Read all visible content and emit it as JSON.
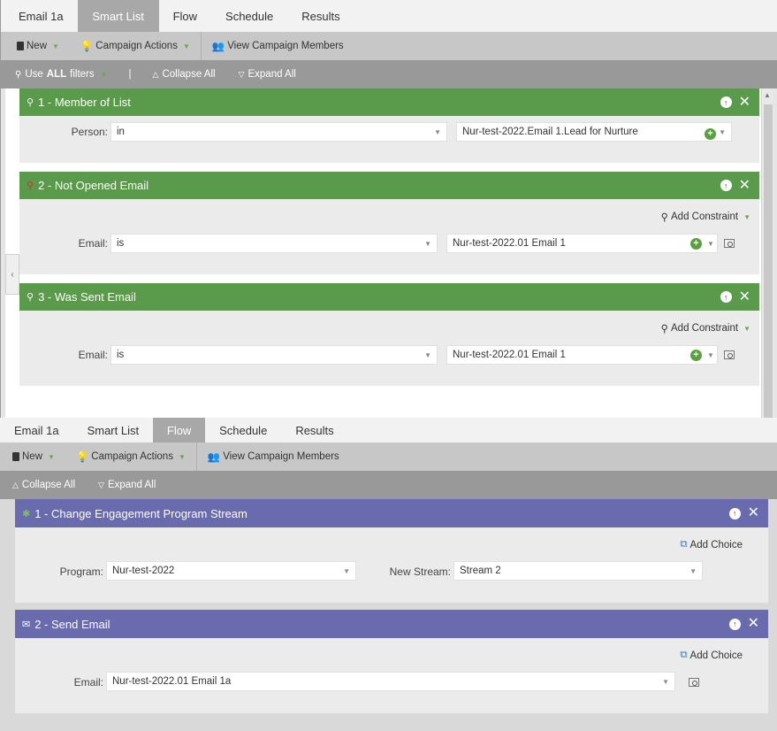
{
  "top": {
    "tabs": [
      "Email 1a",
      "Smart List",
      "Flow",
      "Schedule",
      "Results"
    ],
    "active_tab": "Smart List",
    "toolbar": {
      "new_label": "New",
      "campaign_actions_label": "Campaign Actions",
      "view_members_label": "View Campaign Members"
    },
    "filterbar": {
      "use_prefix": "Use",
      "use_all": "ALL",
      "use_suffix": "filters",
      "divider": "|",
      "collapse_label": "Collapse All",
      "expand_label": "Expand All"
    },
    "filters": [
      {
        "title": "1 - Member of List",
        "row_label": "Person:",
        "operator": "in",
        "value": "Nur-test-2022.Email 1.Lead for Nurture"
      },
      {
        "title": "2 - Not Opened Email",
        "add_constraint": "Add Constraint",
        "row_label": "Email:",
        "operator": "is",
        "value": "Nur-test-2022.01 Email 1"
      },
      {
        "title": "3 - Was Sent Email",
        "add_constraint": "Add Constraint",
        "row_label": "Email:",
        "operator": "is",
        "value": "Nur-test-2022.01 Email 1"
      }
    ]
  },
  "bottom": {
    "tabs": [
      "Email 1a",
      "Smart List",
      "Flow",
      "Schedule",
      "Results"
    ],
    "active_tab": "Flow",
    "toolbar": {
      "new_label": "New",
      "campaign_actions_label": "Campaign Actions",
      "view_members_label": "View Campaign Members"
    },
    "filterbar": {
      "collapse_label": "Collapse All",
      "expand_label": "Expand All"
    },
    "steps": [
      {
        "title": "1 - Change Engagement Program Stream",
        "add_choice": "Add Choice",
        "program_label": "Program:",
        "program_value": "Nur-test-2022",
        "stream_label": "New Stream:",
        "stream_value": "Stream 2"
      },
      {
        "title": "2 - Send Email",
        "add_choice": "Add Choice",
        "email_label": "Email:",
        "email_value": "Nur-test-2022.01 Email 1a"
      }
    ]
  },
  "colors": {
    "filter_header": "#5a9a4b",
    "flow_header": "#6a6aaf",
    "active_tab": "#a8a8a8",
    "plus_icon": "#5aa043"
  }
}
